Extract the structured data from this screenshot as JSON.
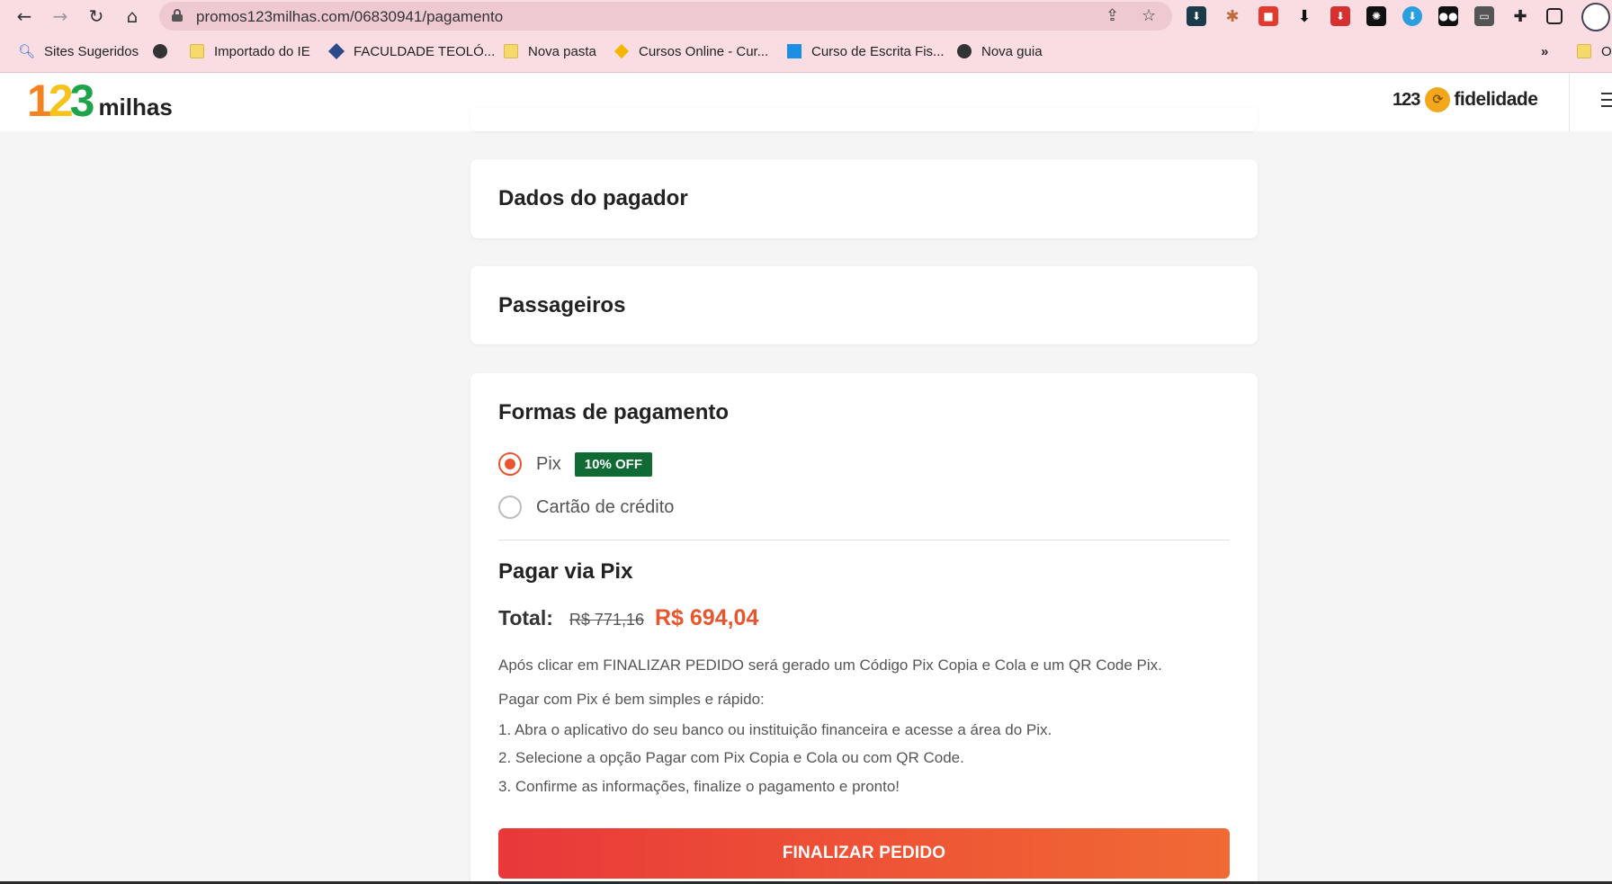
{
  "browser": {
    "url": "promos123milhas.com/06830941/pagamento",
    "bookmarks": [
      {
        "label": "Sites Sugeridos",
        "icon": "search-icon"
      },
      {
        "label": "",
        "icon": "globe-icon"
      },
      {
        "label": "Importado do IE",
        "icon": "folder-icon"
      },
      {
        "label": "FACULDADE TEOLÓ...",
        "icon": "bookmark-icon"
      },
      {
        "label": "Nova pasta",
        "icon": "folder-icon"
      },
      {
        "label": "Cursos Online - Cur...",
        "icon": "site-icon"
      },
      {
        "label": "Curso de Escrita Fis...",
        "icon": "site-icon"
      },
      {
        "label": "Nova guia",
        "icon": "globe-icon"
      },
      {
        "label": "O",
        "icon": "folder-icon"
      }
    ],
    "more_bookmarks": "»"
  },
  "header": {
    "logo_digits": [
      "1",
      "2",
      "3"
    ],
    "logo_colors": [
      "#f58220",
      "#f6c21c",
      "#1fa34a"
    ],
    "logo_word": "milhas",
    "fidelidade_number": "123",
    "fidelidade_word": "fidelidade"
  },
  "sections": {
    "payer": "Dados do pagador",
    "passengers": "Passageiros"
  },
  "payment": {
    "title": "Formas de pagamento",
    "options": [
      {
        "label": "Pix",
        "selected": true,
        "badge": "10% OFF"
      },
      {
        "label": "Cartão de crédito",
        "selected": false
      }
    ],
    "pix_title": "Pagar via Pix",
    "total_label": "Total:",
    "old_price": "R$ 771,16",
    "new_price": "R$ 694,04",
    "info_line": "Após clicar em FINALIZAR PEDIDO será gerado um Código Pix Copia e Cola e um QR Code Pix.",
    "intro": "Pagar com Pix é bem simples e rápido:",
    "steps": [
      "1. Abra o aplicativo do seu banco ou instituição financeira e acesse a área do Pix.",
      "2. Selecione a opção Pagar com Pix Copia e Cola ou com QR Code.",
      "3. Confirme as informações, finalize o pagamento e pronto!"
    ],
    "cta": "FINALIZAR PEDIDO"
  },
  "colors": {
    "accent": "#e8552f",
    "badge": "#0f6b33"
  }
}
